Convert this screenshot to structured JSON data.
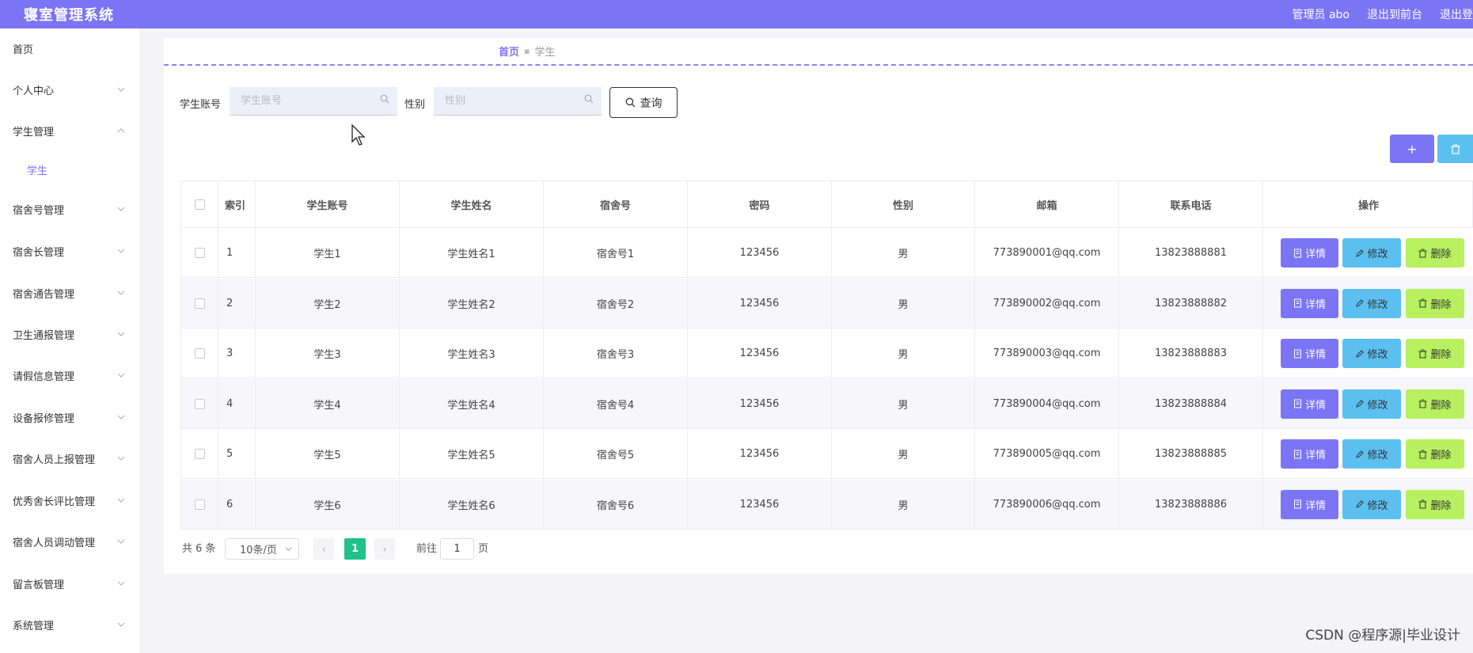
{
  "header": {
    "app_title": "寝室管理系统",
    "admin_label": "管理员 abo",
    "front_label": "退出到前台",
    "logout_label": "退出登"
  },
  "sidebar": {
    "items": [
      {
        "label": "首页",
        "has_chevron": false
      },
      {
        "label": "个人中心",
        "has_chevron": true
      },
      {
        "label": "学生管理",
        "has_chevron": true,
        "expanded": true
      },
      {
        "label": "学生",
        "sub": true
      },
      {
        "label": "宿舍号管理",
        "has_chevron": true
      },
      {
        "label": "宿舍长管理",
        "has_chevron": true
      },
      {
        "label": "宿舍通告管理",
        "has_chevron": true
      },
      {
        "label": "卫生通报管理",
        "has_chevron": true
      },
      {
        "label": "请假信息管理",
        "has_chevron": true
      },
      {
        "label": "设备报修管理",
        "has_chevron": true
      },
      {
        "label": "宿舍人员上报管理",
        "has_chevron": true
      },
      {
        "label": "优秀舍长评比管理",
        "has_chevron": true
      },
      {
        "label": "宿舍人员调动管理",
        "has_chevron": true
      },
      {
        "label": "留言板管理",
        "has_chevron": true
      },
      {
        "label": "系统管理",
        "has_chevron": true
      }
    ]
  },
  "breadcrumb": {
    "home": "首页",
    "current": "学生"
  },
  "search": {
    "account_label": "学生账号",
    "account_placeholder": "学生账号",
    "gender_label": "性别",
    "gender_placeholder": "性别",
    "query_button": "查询"
  },
  "toolbar": {
    "add_label": "+"
  },
  "table": {
    "columns": [
      "索引",
      "学生账号",
      "学生姓名",
      "宿舍号",
      "密码",
      "性别",
      "邮箱",
      "联系电话",
      "操作"
    ],
    "rows": [
      [
        "1",
        "学生1",
        "学生姓名1",
        "宿舍号1",
        "123456",
        "男",
        "773890001@qq.com",
        "13823888881"
      ],
      [
        "2",
        "学生2",
        "学生姓名2",
        "宿舍号2",
        "123456",
        "男",
        "773890002@qq.com",
        "13823888882"
      ],
      [
        "3",
        "学生3",
        "学生姓名3",
        "宿舍号3",
        "123456",
        "男",
        "773890003@qq.com",
        "13823888883"
      ],
      [
        "4",
        "学生4",
        "学生姓名4",
        "宿舍号4",
        "123456",
        "男",
        "773890004@qq.com",
        "13823888884"
      ],
      [
        "5",
        "学生5",
        "学生姓名5",
        "宿舍号5",
        "123456",
        "男",
        "773890005@qq.com",
        "13823888885"
      ],
      [
        "6",
        "学生6",
        "学生姓名6",
        "宿舍号6",
        "123456",
        "男",
        "773890006@qq.com",
        "13823888886"
      ]
    ],
    "actions": {
      "detail": "详情",
      "edit": "修改",
      "delete": "删除"
    }
  },
  "pagination": {
    "total": "共 6 条",
    "page_size": "10条/页",
    "current_page": "1",
    "goto_label": "前往",
    "goto_value": "1",
    "page_suffix": "页"
  },
  "watermark": "CSDN @程序源|毕业设计",
  "colors": {
    "primary": "#7b75f5",
    "info": "#5bc0f0",
    "danger_light": "#b8f060",
    "page_active": "#22c08b"
  }
}
